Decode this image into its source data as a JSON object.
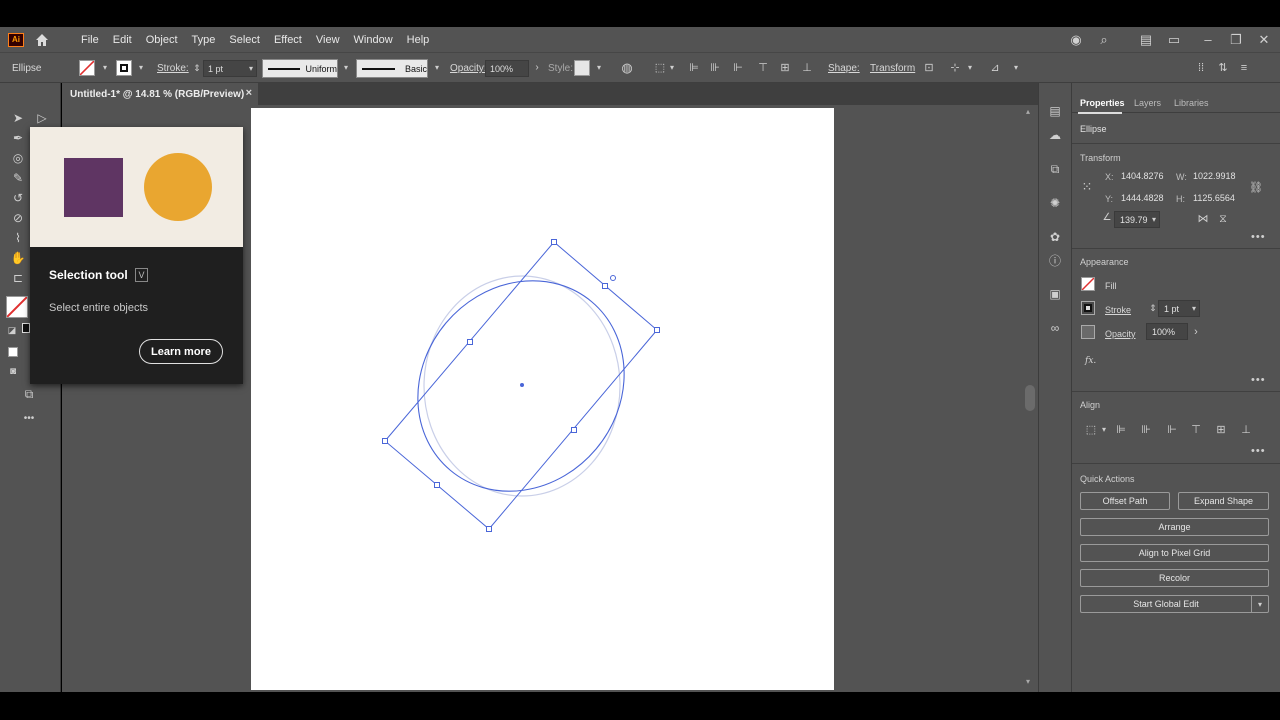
{
  "app": {
    "logo_text": "Ai",
    "menu": [
      "File",
      "Edit",
      "Object",
      "Type",
      "Select",
      "Effect",
      "View",
      "Window",
      "Help"
    ]
  },
  "control_bar": {
    "object_type": "Ellipse",
    "stroke_label": "Stroke:",
    "stroke_weight": "1 pt",
    "profile_uniform": "Uniform",
    "brush_basic": "Basic",
    "opacity_label": "Opacity:",
    "opacity_value": "100%",
    "style_label": "Style:",
    "shape_label": "Shape:",
    "transform_label": "Transform"
  },
  "document_tab": {
    "title": "Untitled-1* @ 14.81 % (RGB/Preview)",
    "close": "×"
  },
  "tooltip": {
    "title": "Selection tool",
    "shortcut": "V",
    "description": "Select entire objects",
    "button": "Learn more",
    "colors": {
      "square": "#5f3563",
      "circle": "#e9a630",
      "background": "#f2ece3"
    }
  },
  "properties_panel": {
    "tabs": [
      "Properties",
      "Layers",
      "Libraries"
    ],
    "object_type": "Ellipse",
    "transform": {
      "heading": "Transform",
      "x_label": "X:",
      "x": "1404.8276",
      "y_label": "Y:",
      "y": "1444.4828",
      "w_label": "W:",
      "w": "1022.9918",
      "h_label": "H:",
      "h": "1125.6564",
      "angle": "139.79"
    },
    "appearance": {
      "heading": "Appearance",
      "fill_label": "Fill",
      "stroke_label": "Stroke",
      "stroke_value": "1 pt",
      "opacity_label": "Opacity",
      "opacity_value": "100%",
      "fx_label": "fx."
    },
    "align": {
      "heading": "Align"
    },
    "quick_actions": {
      "heading": "Quick Actions",
      "offset_path": "Offset Path",
      "expand_shape": "Expand Shape",
      "arrange": "Arrange",
      "align_pixel_grid": "Align to Pixel Grid",
      "recolor": "Recolor",
      "start_global_edit": "Start Global Edit"
    }
  },
  "colors": {
    "ui_dark": "#535353",
    "selection_blue": "#4a66d8"
  }
}
